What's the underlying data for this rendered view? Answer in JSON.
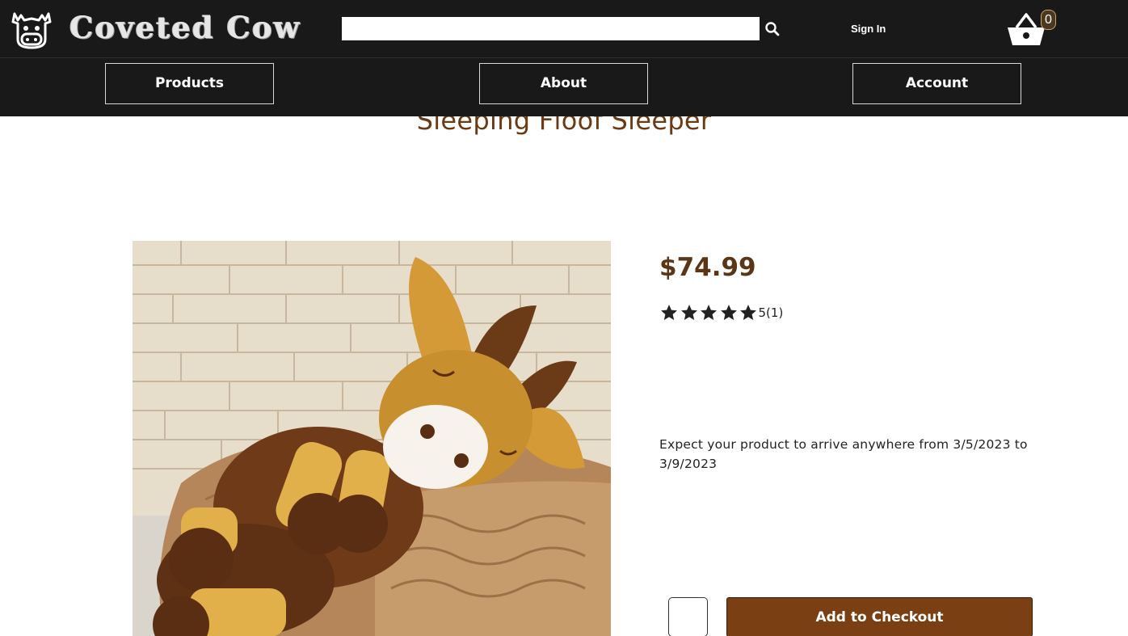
{
  "header": {
    "brand_name": "Coveted Cow",
    "logo_icon": "cow-head-icon",
    "search": {
      "placeholder": "",
      "value": "",
      "icon": "search-icon"
    },
    "sign_in_label": "Sign In",
    "cart": {
      "icon": "basket-icon",
      "count": "0"
    }
  },
  "nav": {
    "products_label": "Products",
    "about_label": "About",
    "account_label": "Account"
  },
  "product": {
    "title": "Sleeping Floof Sleeper",
    "image_alt": "Crocheted plush cow lying on a knitted blanket",
    "price": "$74.99",
    "rating": {
      "stars": 5,
      "value": "5",
      "count": "(1)"
    },
    "delivery_text": "Expect your product to arrive anywhere from 3/5/2023 to 3/9/2023",
    "quantity_value": "",
    "add_to_checkout_label": "Add to Checkout"
  },
  "colors": {
    "header_bg": "#191919",
    "title_brown": "#6b3a12",
    "price_brown": "#5b3515",
    "button_brown": "#7a3f12"
  }
}
